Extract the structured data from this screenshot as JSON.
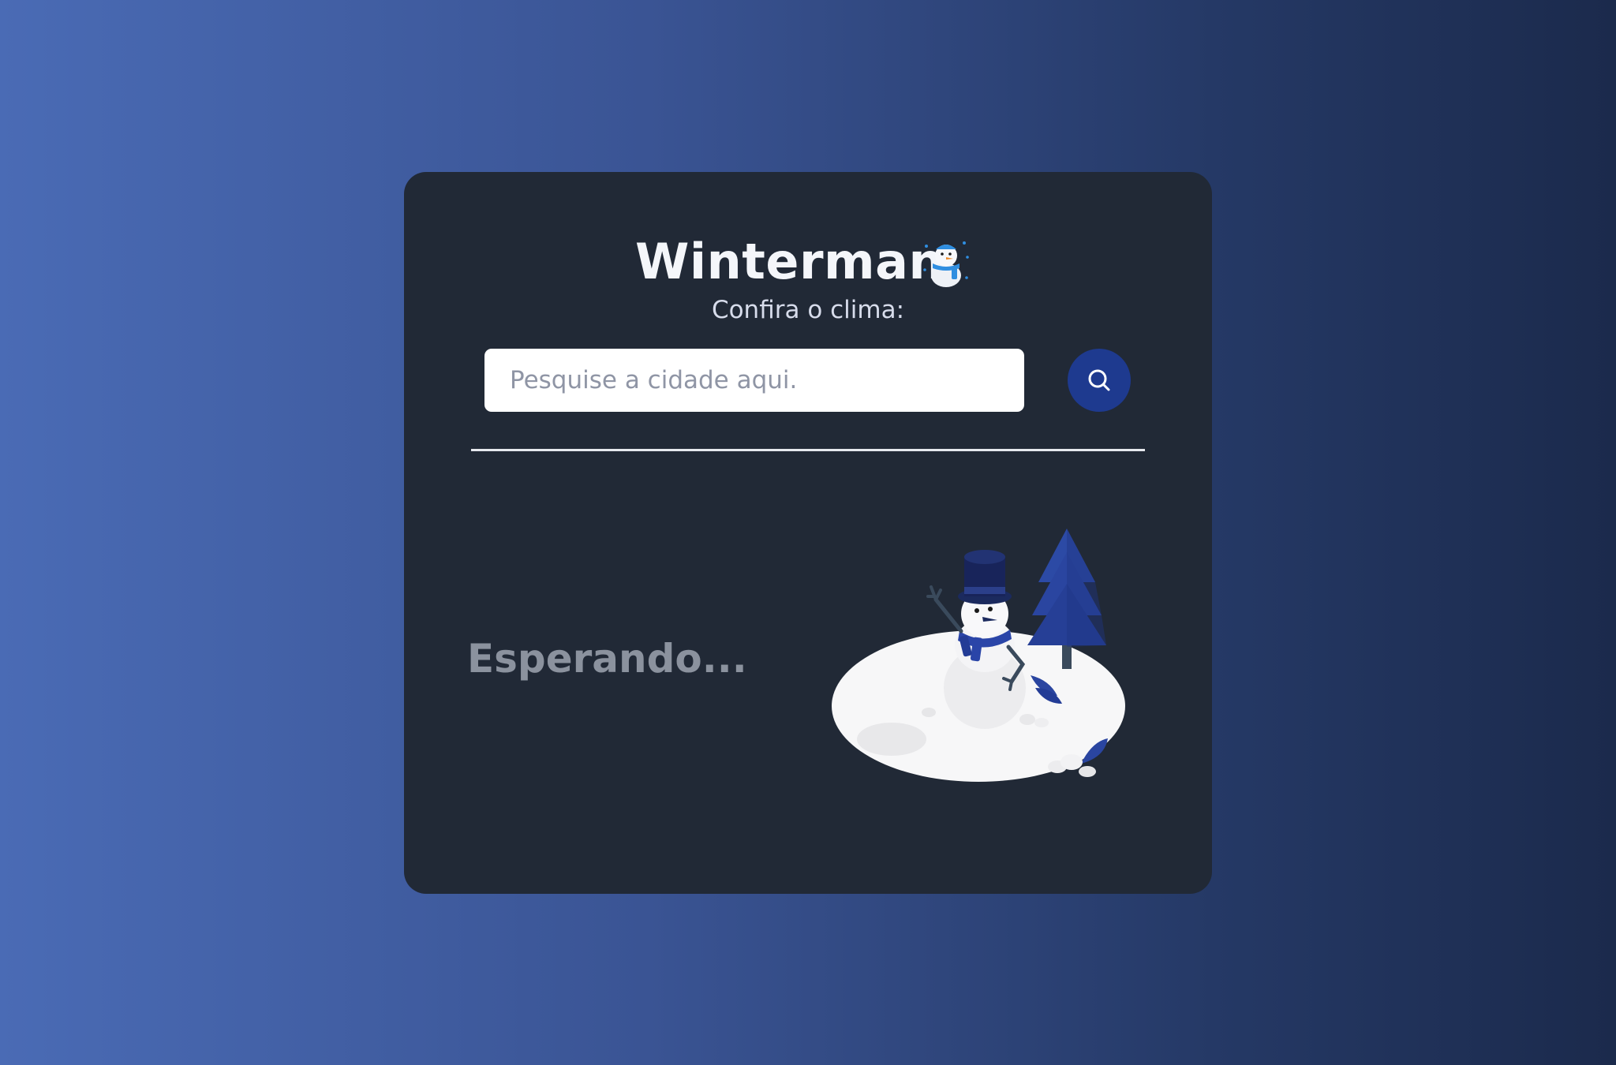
{
  "app": {
    "title": "Winterman",
    "title_icon": "snowman-emoji-icon",
    "subtitle": "Confira o clima:"
  },
  "search": {
    "placeholder": "Pesquise a cidade aqui.",
    "value": "",
    "button_icon": "search-icon"
  },
  "result": {
    "status": "Esperando..."
  },
  "illustration": {
    "name": "snowman-illustration"
  },
  "colors": {
    "card_bg": "#212936",
    "accent": "#1e3a8f",
    "text_primary": "#f4f6fa",
    "text_muted": "#8b929e"
  }
}
